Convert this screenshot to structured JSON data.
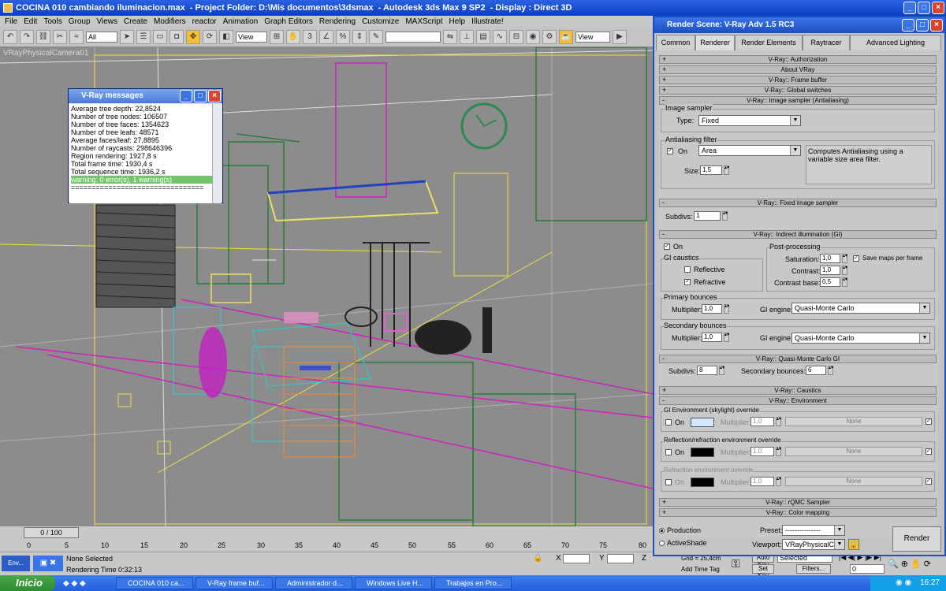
{
  "app": {
    "title_parts": [
      "COCINA 010 cambiando iluminacion.max",
      "- Project Folder: D:\\Mis documentos\\3dsmax",
      "- Autodesk 3ds Max 9 SP2",
      "- Display : Direct 3D"
    ]
  },
  "menu": [
    "File",
    "Edit",
    "Tools",
    "Group",
    "Views",
    "Create",
    "Modifiers",
    "reactor",
    "Animation",
    "Graph Editors",
    "Rendering",
    "Customize",
    "MAXScript",
    "Help",
    "Illustrate!"
  ],
  "toolbar": {
    "filter": "All",
    "coord": "View",
    "view2": "View"
  },
  "viewport": {
    "label": "VRayPhysicalCamera01"
  },
  "vray_messages": {
    "title": "V-Ray messages",
    "lines": [
      "Average tree depth: 22,8524",
      "Number of tree nodes: 106507",
      "Number of tree faces: 1354623",
      "Number of tree leafs: 48571",
      "Average faces/leaf: 27,8895",
      "Number of raycasts: 298646396",
      "Region rendering: 1927,8 s",
      "Total frame time: 1930,4 s",
      "Total sequence time: 1936,2 s"
    ],
    "warning": "warning: 0 error(s), 1 warning(s)",
    "separator": "================================"
  },
  "timeline": {
    "frame": "0 / 100",
    "ticks": [
      "0",
      "5",
      "10",
      "15",
      "20",
      "25",
      "30",
      "35",
      "40",
      "45",
      "50",
      "55",
      "60",
      "65",
      "70",
      "75",
      "80"
    ]
  },
  "status": {
    "selected": "None Selected",
    "time": "Rendering Time 0:32:13",
    "x_label": "X",
    "y_label": "Y",
    "z_label": "Z",
    "grid": "Grid = 25,4cm",
    "add_time_tag": "Add Time Tag",
    "auto_key": "Auto Key",
    "set_key": "Set Key",
    "selected_dd": "Selected",
    "filters": "Filters...",
    "frame_field": "0"
  },
  "taskbar": {
    "start": "Inicio",
    "tasks": [
      "COCINA 010 ca...",
      "V-Ray frame buf...",
      "Administrador d...",
      "Windows Live H...",
      "Trabajos en Pro..."
    ],
    "clock": "16:27",
    "env": "Env..."
  },
  "render": {
    "title": "Render Scene: V-Ray Adv 1.5 RC3",
    "tabs": [
      "Common",
      "Renderer",
      "Render Elements",
      "Raytracer",
      "Advanced Lighting"
    ],
    "rollouts": {
      "authorization": "V-Ray:: Authorization",
      "about": "About VRay",
      "frame_buffer": "V-Ray:: Frame buffer",
      "global_switches": "V-Ray:: Global switches",
      "image_sampler": "V-Ray:: Image sampler (Antialiasing)",
      "fixed_sampler": "V-Ray:: Fixed image sampler",
      "indirect": "V-Ray:: Indirect illumination (GI)",
      "qmc_gi": "V-Ray:: Quasi-Monte Carlo GI",
      "caustics": "V-Ray:: Caustics",
      "environment": "V-Ray:: Environment",
      "rqmc": "V-Ray:: rQMC Sampler",
      "color_mapping": "V-Ray:: Color mapping"
    },
    "image_sampler": {
      "group": "Image sampler",
      "type_label": "Type:",
      "type_value": "Fixed",
      "aa_group": "Antialiasing filter",
      "on_label": "On",
      "filter_value": "Area",
      "size_label": "Size:",
      "size_value": "1,5",
      "description": "Computes Antialiasing using a variable size area filter."
    },
    "fixed": {
      "subdivs_label": "Subdivs:",
      "subdivs_value": "1"
    },
    "gi": {
      "on_label": "On",
      "caustics_group": "GI caustics",
      "reflective": "Reflective",
      "refractive": "Refractive",
      "post_group": "Post-processing",
      "saturation_label": "Saturation:",
      "saturation_value": "1,0",
      "save_maps": "Save maps per frame",
      "contrast_label": "Contrast:",
      "contrast_value": "1,0",
      "contrast_base_label": "Contrast base:",
      "contrast_base_value": "0,5",
      "primary_group": "Primary bounces",
      "primary_mult_label": "Multiplier:",
      "primary_mult_value": "1,0",
      "primary_engine_label": "GI engine:",
      "primary_engine_value": "Quasi-Monte Carlo",
      "secondary_group": "Secondary bounces",
      "secondary_mult_label": "Multiplier:",
      "secondary_mult_value": "1,0",
      "secondary_engine_label": "GI engine:",
      "secondary_engine_value": "Quasi-Monte Carlo"
    },
    "qmc": {
      "subdivs_label": "Subdivs:",
      "subdivs_value": "8",
      "secondary_label": "Secondary bounces:",
      "secondary_value": "6"
    },
    "env": {
      "gi_group": "GI Environment (skylight) override",
      "refl_group": "Reflection/refraction environment override",
      "refr_group": "Refraction environment override",
      "on_label": "On",
      "mult_label": "Multiplier:",
      "mult_value": "1,0",
      "none_label": "None",
      "gi_color": "#d6e8ff",
      "refl_color": "#000000",
      "refr_color": "#000000"
    },
    "bottom": {
      "production": "Production",
      "activeshade": "ActiveShade",
      "preset_label": "Preset:",
      "preset_value": "---------------",
      "viewport_label": "Viewport:",
      "viewport_value": "VRayPhysicalCa",
      "render_button": "Render"
    }
  }
}
